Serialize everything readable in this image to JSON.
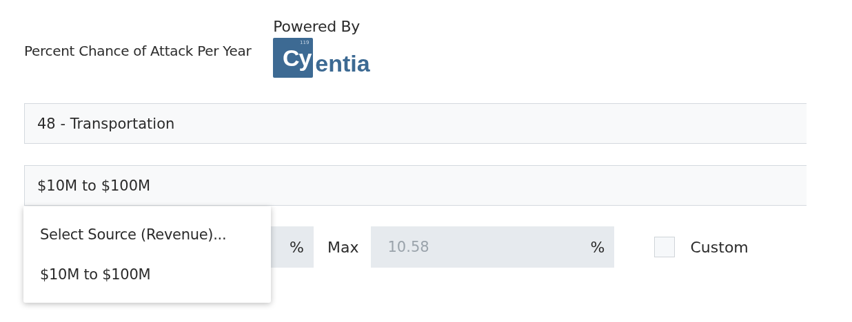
{
  "header": {
    "label": "Percent Chance of Attack Per Year",
    "powered_by": "Powered By",
    "logo": {
      "boxed": "Cy",
      "rest": "entia",
      "superscript": "119"
    }
  },
  "industry_select": {
    "value": "48 - Transportation"
  },
  "revenue_select": {
    "value": "$10M to $100M",
    "expanded": true
  },
  "range": {
    "min_unit": "%",
    "max_label": "Max",
    "max_placeholder": "10.58",
    "max_unit": "%"
  },
  "custom": {
    "label": "Custom",
    "checked": false
  },
  "dropdown": {
    "options": [
      {
        "label": "Select Source (Revenue)...",
        "selected": false
      },
      {
        "label": "$10M to $100M",
        "selected": false
      }
    ]
  }
}
